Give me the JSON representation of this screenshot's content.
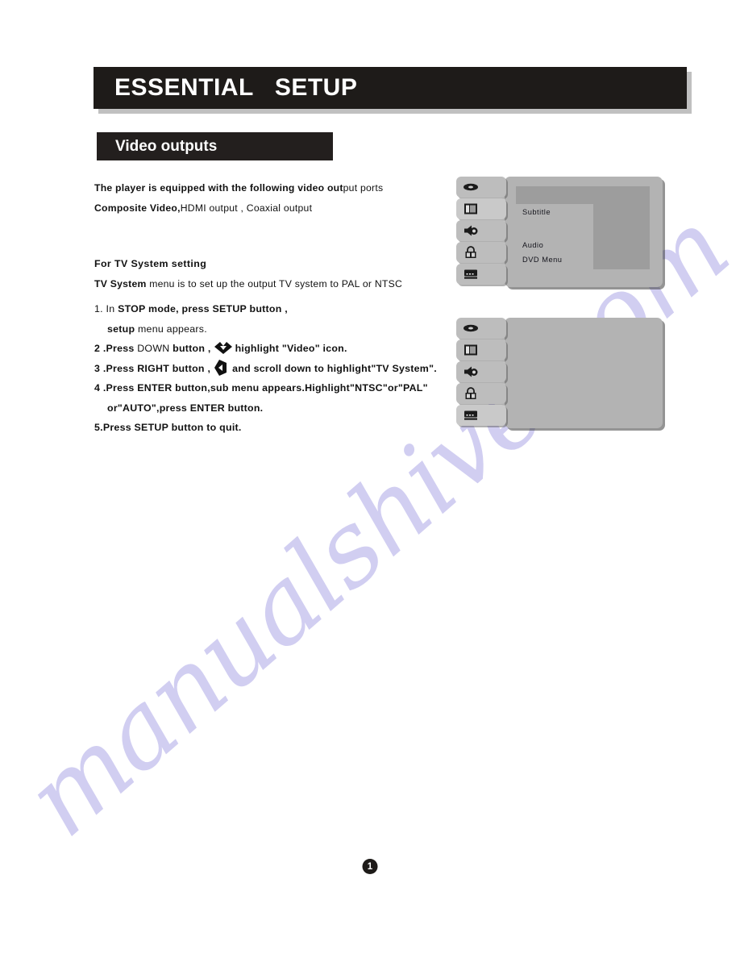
{
  "document": {
    "title": "ESSENTIAL   SETUP",
    "section_title": "Video outputs",
    "page_number": "1",
    "watermark": "manualshive.com"
  },
  "colors": {
    "header_bar": "#1e1b19",
    "header_shadow": "#c0c0c0",
    "section_bar": "#231f1e",
    "panel_light": "#b3b3b3",
    "panel_dark": "#9d9d9d",
    "tab_bg": "#bdbdbd",
    "tab_selected": "#c9c9c9",
    "watermark": "#c9c6ef",
    "text": "#111111"
  },
  "intro": {
    "line1_bold": "The player is equipped with the following video out",
    "line1_rest": "put ports",
    "line2_bold": "Composite Video,",
    "line2_rest": "HDMI output , Coaxial output"
  },
  "tv_system": {
    "subhead": "For TV System setting",
    "lead_bold": "TV System",
    "lead_rest": " menu is to set up the output TV system to PAL or NTSC"
  },
  "steps": [
    {
      "id": "step-1",
      "prefix": "1. In ",
      "bold_a": "STOP",
      "mid_a": " mode, press ",
      "bold_b": "SETUP",
      "tail": " button ,"
    },
    {
      "id": "step-1-cont",
      "bold_a": "setup",
      "tail": " menu appears."
    },
    {
      "id": "step-2",
      "prefix": "2 .",
      "bold_a": "Press ",
      "mid_a": "DOWN",
      "bold_b": "  button ,",
      "icon": "down-arrow-diamond",
      "tail": "highlight \"Video\" icon."
    },
    {
      "id": "step-3",
      "prefix": "3 .",
      "bold_a": "Press RIGHT button ,",
      "icon": "left-right-arrow-diamond",
      "tail": "and scroll down to highlight\"TV System\"."
    },
    {
      "id": "step-4",
      "prefix": "4 .",
      "bold_a": "Press ENTER button,sub menu appears.Highlight\"NTSC\"or\"PAL\""
    },
    {
      "id": "step-4-cont",
      "bold_a": "or\"AUTO\",press ENTER button."
    },
    {
      "id": "step-5",
      "prefix": "5.",
      "bold_a": "Press SETUP button to quit."
    }
  ],
  "screen_mockups": [
    {
      "id": "setup-screen-language",
      "tabs": [
        {
          "name": "general-setup",
          "icon": "disc-icon",
          "selected": false
        },
        {
          "name": "video-setup",
          "icon": "video-icon",
          "selected": true
        },
        {
          "name": "audio-setup",
          "icon": "speaker-icon",
          "selected": false
        },
        {
          "name": "parental-setup",
          "icon": "lock-icon",
          "selected": false
        },
        {
          "name": "language-setup",
          "icon": "subtitle-icon",
          "selected": false
        }
      ],
      "menu_items": [
        "Subtitle",
        "Audio",
        "DVD Menu"
      ]
    },
    {
      "id": "setup-screen-blank",
      "tabs": [
        {
          "name": "general-setup",
          "icon": "disc-icon",
          "selected": false
        },
        {
          "name": "video-setup",
          "icon": "video-icon",
          "selected": false
        },
        {
          "name": "audio-setup",
          "icon": "speaker-icon",
          "selected": false
        },
        {
          "name": "parental-setup",
          "icon": "lock-icon",
          "selected": false
        },
        {
          "name": "language-setup",
          "icon": "subtitle-icon",
          "selected": true
        }
      ],
      "menu_items": []
    }
  ]
}
